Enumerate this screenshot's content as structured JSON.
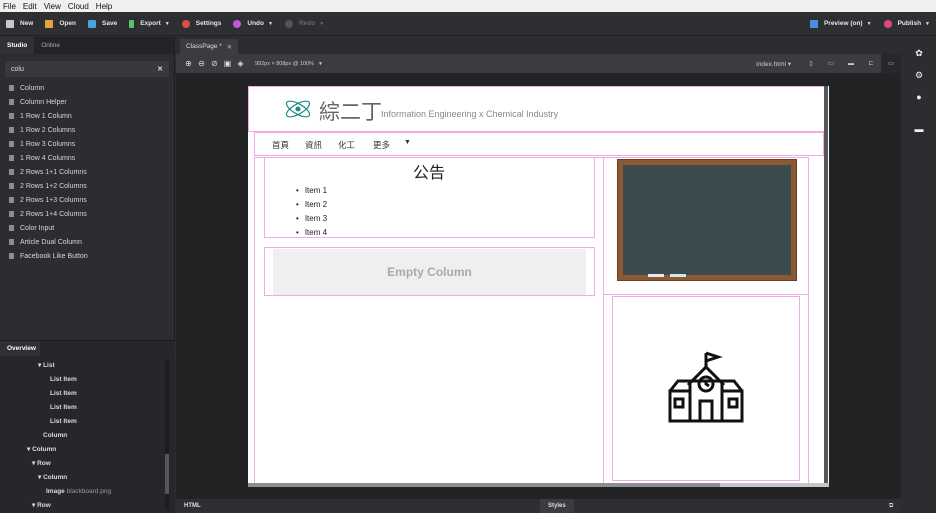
{
  "menu": [
    "File",
    "Edit",
    "View",
    "Cloud",
    "Help"
  ],
  "toolbar": {
    "new": "New",
    "open": "Open",
    "save": "Save",
    "export": "Export",
    "settings": "Settings",
    "undo": "Undo",
    "redo": "Redo",
    "preview": "Preview (on)",
    "publish": "Publish"
  },
  "left": {
    "tabs": [
      "Studio",
      "Online"
    ],
    "search_value": "colu",
    "components": [
      "Column",
      "Column Helper",
      "1 Row 1 Column",
      "1 Row 2 Columns",
      "1 Row 3 Columns",
      "1 Row 4 Columns",
      "2 Rows 1+1 Columns",
      "2 Rows 1+2 Columns",
      "2 Rows 1+3 Columns",
      "2 Rows 1+4 Columns",
      "Color Input",
      "Article Dual Column",
      "Facebook Like Button"
    ]
  },
  "overview": {
    "title": "Overview",
    "nodes": [
      "List",
      "List Item",
      "List Item",
      "List Item",
      "List Item",
      "Column",
      "Column",
      "Row",
      "Column",
      "Image",
      "Row"
    ],
    "image_file": "blackboard.png"
  },
  "editor": {
    "tab": "ClassPage *",
    "size_text": "992px × 808px @ 100%",
    "file": "index.html",
    "bottom_html": "HTML",
    "bottom_styles": "Styles"
  },
  "page": {
    "brand": "綜二丁",
    "brand_sub": "Information Engineering x Chemical Industry",
    "nav": [
      "首頁",
      "資訊",
      "化工",
      "更多"
    ],
    "announce_title": "公告",
    "items": [
      "Item 1",
      "Item 2",
      "Item 3",
      "Item 4"
    ],
    "empty_column": "Empty Column"
  },
  "colors": {
    "accent_pink": "#f3a9e6",
    "toolbar_bg": "#2d2f33",
    "panel_bg": "#2b2d31"
  }
}
